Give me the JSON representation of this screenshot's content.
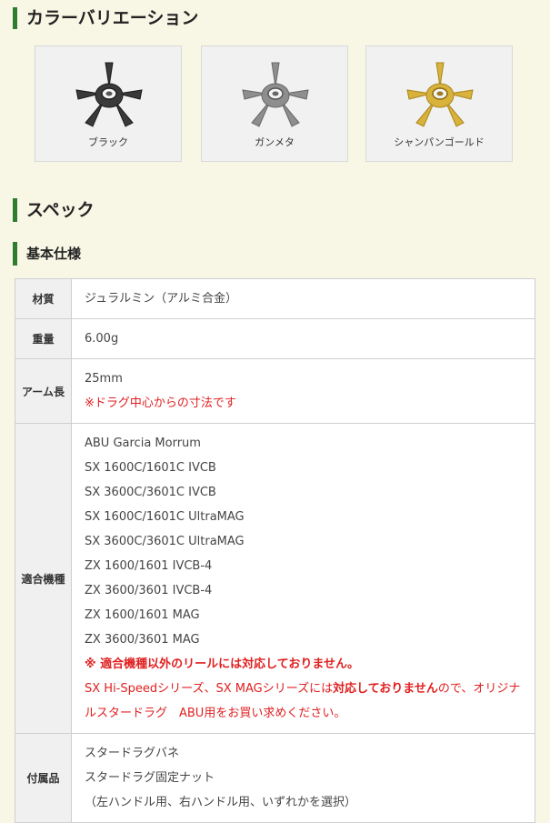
{
  "sections": {
    "color_heading": "カラーバリエーション",
    "spec_heading": "スペック",
    "basic_heading": "基本仕様"
  },
  "variants": [
    {
      "label": "ブラック",
      "color": "#3a3a3a",
      "icon": "star-drag-black-icon"
    },
    {
      "label": "ガンメタ",
      "color": "#8e8e8e",
      "icon": "star-drag-gunmetal-icon"
    },
    {
      "label": "シャンパンゴールド",
      "color": "#d8b23a",
      "icon": "star-drag-gold-icon"
    }
  ],
  "spec": {
    "material": {
      "label": "材質",
      "value": "ジュラルミン（アルミ合金）"
    },
    "weight": {
      "label": "重量",
      "value": "6.00g"
    },
    "arm_length": {
      "label": "アーム長",
      "value": "25mm",
      "note": "※ドラグ中心からの寸法です"
    },
    "compatible": {
      "label": "適合機種",
      "models": [
        "ABU Garcia Morrum",
        "SX 1600C/1601C IVCB",
        "SX 3600C/3601C IVCB",
        "SX 1600C/1601C UltraMAG",
        "SX 3600C/3601C UltraMAG",
        "ZX 1600/1601 IVCB-4",
        "ZX 3600/3601 IVCB-4",
        "ZX 1600/1601 MAG",
        "ZX 3600/3601 MAG"
      ],
      "warning": "※ 適合機種以外のリールには対応しておりません。",
      "note_prefix": "SX Hi-Speedシリーズ、SX MAGシリーズには",
      "note_bold": "対応しておりません",
      "note_suffix": "ので、オリジナルスタードラグ　ABU用をお買い求めください。"
    },
    "accessories": {
      "label": "付属品",
      "items": [
        "スタードラグバネ",
        "スタードラグ固定ナット",
        "（左ハンドル用、右ハンドル用、いずれかを選択）"
      ]
    }
  }
}
